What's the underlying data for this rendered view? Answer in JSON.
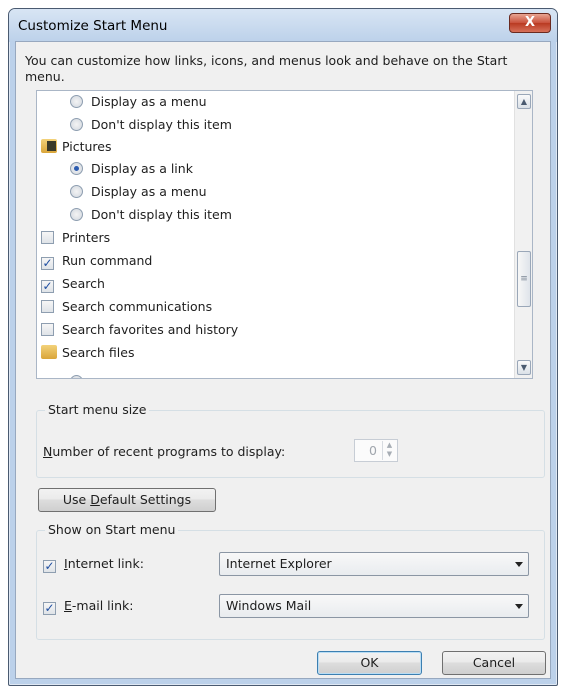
{
  "window": {
    "title": "Customize Start Menu",
    "close_label": "X",
    "intro": "You can customize how links, icons, and menus look and behave on the Start menu."
  },
  "list_items": [
    {
      "kind": "radio",
      "label": "Display as a menu",
      "checked": false
    },
    {
      "kind": "radio",
      "label": "Don't display this item",
      "checked": false
    },
    {
      "kind": "folder",
      "label": "Pictures"
    },
    {
      "kind": "radio",
      "label": "Display as a link",
      "checked": true
    },
    {
      "kind": "radio",
      "label": "Display as a menu",
      "checked": false
    },
    {
      "kind": "radio",
      "label": "Don't display this item",
      "checked": false
    },
    {
      "kind": "check",
      "label": "Printers",
      "checked": false
    },
    {
      "kind": "check",
      "label": "Run command",
      "checked": true
    },
    {
      "kind": "check",
      "label": "Search",
      "checked": true
    },
    {
      "kind": "check",
      "label": "Search communications",
      "checked": false
    },
    {
      "kind": "check",
      "label": "Search favorites and history",
      "checked": false
    },
    {
      "kind": "folder",
      "label": "Search files"
    }
  ],
  "start_menu_size": {
    "group_label": "Start menu size",
    "recent_prefix": "N",
    "recent_label": "umber of recent programs to display:",
    "recent_value": "0"
  },
  "default_button": {
    "prefix": "Use ",
    "mnemonic": "D",
    "suffix": "efault Settings"
  },
  "show_on_start": {
    "group_label": "Show on Start menu",
    "internet": {
      "mnemonic": "I",
      "rest": "nternet link:",
      "checked": true,
      "value": "Internet Explorer"
    },
    "email": {
      "mnemonic": "E",
      "rest": "-mail link:",
      "checked": true,
      "value": "Windows Mail"
    }
  },
  "buttons": {
    "ok": "OK",
    "cancel": "Cancel"
  },
  "colors": {
    "accent": "#2c5cb0",
    "close": "#c9503b"
  }
}
